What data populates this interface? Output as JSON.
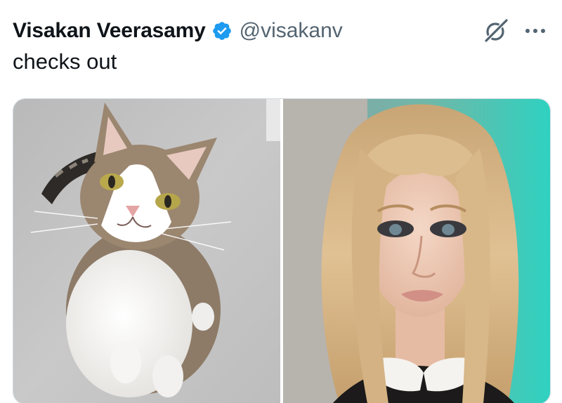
{
  "tweet": {
    "author": {
      "display_name": "Visakan Veerasamy",
      "handle": "@visakanv",
      "verified": true,
      "verified_icon": "verified-badge-icon",
      "verified_color": "#1d9bf0"
    },
    "text": "checks out",
    "actions": {
      "grok_icon": "grok-icon",
      "more_icon": "more-dots-icon"
    },
    "media": [
      {
        "type": "photo",
        "subject": "cat"
      },
      {
        "type": "photo",
        "subject": "woman"
      }
    ]
  }
}
